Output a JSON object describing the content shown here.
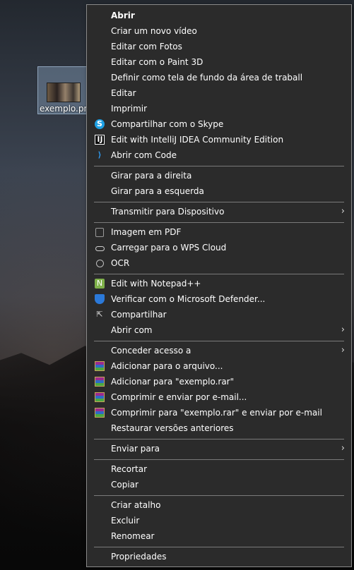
{
  "desktop": {
    "file_label": "exemplo.png"
  },
  "menu": {
    "items": [
      {
        "label": "Abrir"
      },
      {
        "label": "Criar um novo vídeo"
      },
      {
        "label": "Editar com Fotos"
      },
      {
        "label": "Editar com o Paint 3D"
      },
      {
        "label": "Definir como tela de fundo da área de traball"
      },
      {
        "label": "Editar"
      },
      {
        "label": "Imprimir"
      },
      {
        "label": "Compartilhar com o Skype",
        "icon": "skype-icon"
      },
      {
        "label": "Edit with IntelliJ IDEA Community Edition",
        "icon": "intellij-icon"
      },
      {
        "label": "Abrir com Code",
        "icon": "vscode-icon"
      },
      {
        "label": "Girar para a direita"
      },
      {
        "label": "Girar para a esquerda"
      },
      {
        "label": "Transmitir para Dispositivo",
        "submenu": true
      },
      {
        "label": "Imagem em PDF",
        "icon": "pdf-icon"
      },
      {
        "label": "Carregar para o WPS Cloud",
        "icon": "cloud-icon"
      },
      {
        "label": "OCR",
        "icon": "ocr-icon"
      },
      {
        "label": "Edit with Notepad++",
        "icon": "notepad-plus-plus-icon"
      },
      {
        "label": "Verificar com o Microsoft Defender...",
        "icon": "defender-shield-icon"
      },
      {
        "label": "Compartilhar",
        "icon": "share-icon"
      },
      {
        "label": "Abrir com",
        "submenu": true
      },
      {
        "label": "Conceder acesso a",
        "submenu": true
      },
      {
        "label": "Adicionar para o arquivo...",
        "icon": "winrar-icon"
      },
      {
        "label": "Adicionar para \"exemplo.rar\"",
        "icon": "winrar-icon"
      },
      {
        "label": "Comprimir e enviar por e-mail...",
        "icon": "winrar-icon"
      },
      {
        "label": "Comprimir para \"exemplo.rar\" e enviar por e-mail",
        "icon": "winrar-icon"
      },
      {
        "label": "Restaurar versões anteriores"
      },
      {
        "label": "Enviar para",
        "submenu": true
      },
      {
        "label": "Recortar"
      },
      {
        "label": "Copiar"
      },
      {
        "label": "Criar atalho"
      },
      {
        "label": "Excluir"
      },
      {
        "label": "Renomear"
      },
      {
        "label": "Propriedades"
      }
    ],
    "submenu_arrow": "›",
    "icon_glyphs": {
      "skype": "S",
      "intellij": "IJ",
      "vscode": "⟩",
      "notepad": "N",
      "share": "⇱"
    }
  }
}
